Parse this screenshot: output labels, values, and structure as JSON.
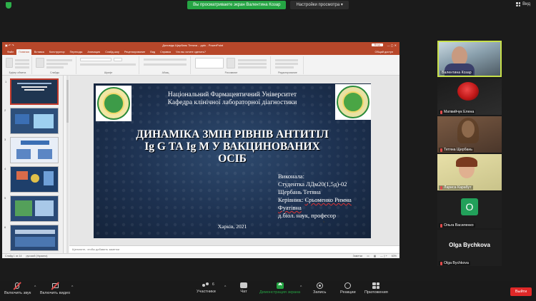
{
  "top_bar": {
    "sharing_notice": "Вы просматриваете экран Валентина Козар",
    "view_options": "Настройки просмотра",
    "view_button": "Вид"
  },
  "ppt": {
    "window_title": "Доповідь Щербань Тетяна - .pptx - PowerPoint",
    "sign_in": "Вход",
    "tabs": [
      "Файл",
      "Главная",
      "Вставка",
      "Конструктор",
      "Переходы",
      "Анимация",
      "Слайд-шоу",
      "Рецензирование",
      "Вид",
      "Справка",
      "Что вы хотите сделать?"
    ],
    "share": "Общий доступ",
    "ribbon_groups": [
      "Буфер обмена",
      "Слайды",
      "Шрифт",
      "Абзац",
      "Рисование",
      "Редактирование"
    ],
    "slide_numbers": [
      "1",
      "2",
      "3",
      "4",
      "5",
      "6"
    ],
    "notes_placeholder": "Щелкните, чтобы добавить заметки",
    "status_left": "Слайд 1 из 14",
    "status_lang": "русский (Украина)",
    "status_notes": "Заметки",
    "status_zoom": "63%"
  },
  "slide": {
    "university": "Національний Фармацевтичний Університет",
    "department": "Кафедра клінічної лабораторної діагностики",
    "title_line1": "ДИНАМІКА ЗМІН РІВНІВ АНТИТІЛ",
    "title_line2": "Ig G ТА Ig M У ВАКЦИНОВАНИХ",
    "title_line3": "ОСІБ",
    "performed_label": "Виконала:",
    "student_group": "Студентка ЛДм20(1,5д)-02",
    "student_name": "Щербань Тетяна",
    "supervisor_label": "Керівник:",
    "supervisor_name": "Єрьоменко Римма",
    "supervisor_name2": "Фуатівна",
    "supervisor_title": "д.біол. наук, професор",
    "city_year": "Харків, 2021"
  },
  "participants": [
    {
      "name": "Валентина Козар",
      "type": "video",
      "active": true
    },
    {
      "name": "Матвийчук Елена",
      "type": "video",
      "active": false
    },
    {
      "name": "Тетяна Щербань",
      "type": "video",
      "active": false
    },
    {
      "name": "Лариса Карабут",
      "type": "video",
      "active": false
    },
    {
      "name": "Ольга Василенко",
      "type": "avatar",
      "initial": "O",
      "active": false
    },
    {
      "name": "Olga Bychkova",
      "display": "Olga Bychkova",
      "type": "name",
      "active": false
    }
  ],
  "toolbar": {
    "unmute": "Включить звук",
    "start_video": "Включить видео",
    "participants": "Участники",
    "participants_count": "6",
    "chat": "Чат",
    "share_screen": "Демонстрация экрана",
    "record": "Запись",
    "reactions": "Реакции",
    "apps": "Приложения",
    "leave": "Выйти"
  },
  "colors": {
    "zoom_green": "#25a443",
    "ppt_red": "#b7472a",
    "leave_red": "#e02828",
    "active_speaker": "#c8e04a"
  }
}
